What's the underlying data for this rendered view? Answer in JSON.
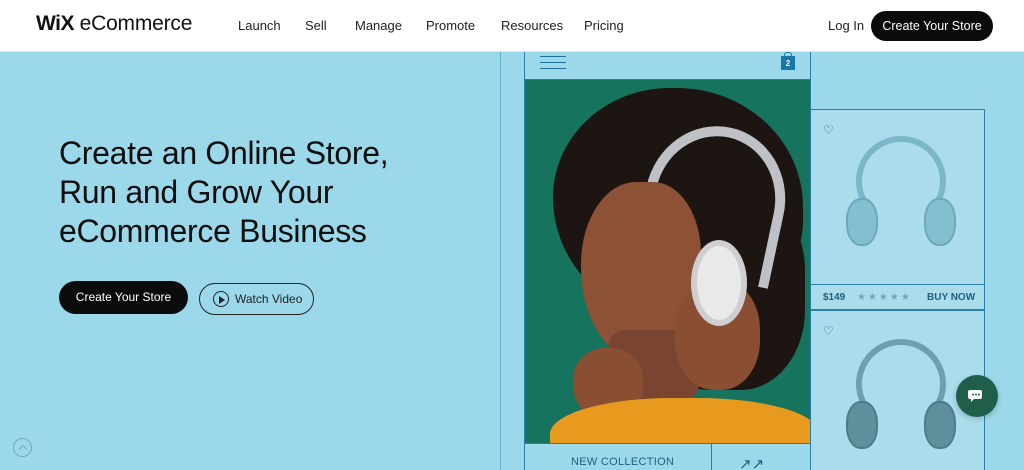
{
  "header": {
    "logo_wix": "WiX",
    "logo_suffix": "eCommerce",
    "nav": [
      "Launch",
      "Sell",
      "Manage",
      "Promote",
      "Resources",
      "Pricing"
    ],
    "login": "Log In",
    "cta": "Create Your Store"
  },
  "hero": {
    "title_lines": [
      "Create an Online Store,",
      "Run and Grow Your",
      "eCommerce Business"
    ],
    "primary_cta": "Create Your Store",
    "video_cta": "Watch Video"
  },
  "mockup": {
    "cart_count": "2",
    "new_collection": "NEW COLLECTION",
    "arrows": "↗↗",
    "product": {
      "price": "$149",
      "stars": "★★★★★",
      "buy": "BUY NOW"
    }
  },
  "colors": {
    "background": "#9bd8ea",
    "accent_dark": "#0b0b0b",
    "mockup_line": "#2a7fa8",
    "chat_button": "#1f5e4a"
  }
}
